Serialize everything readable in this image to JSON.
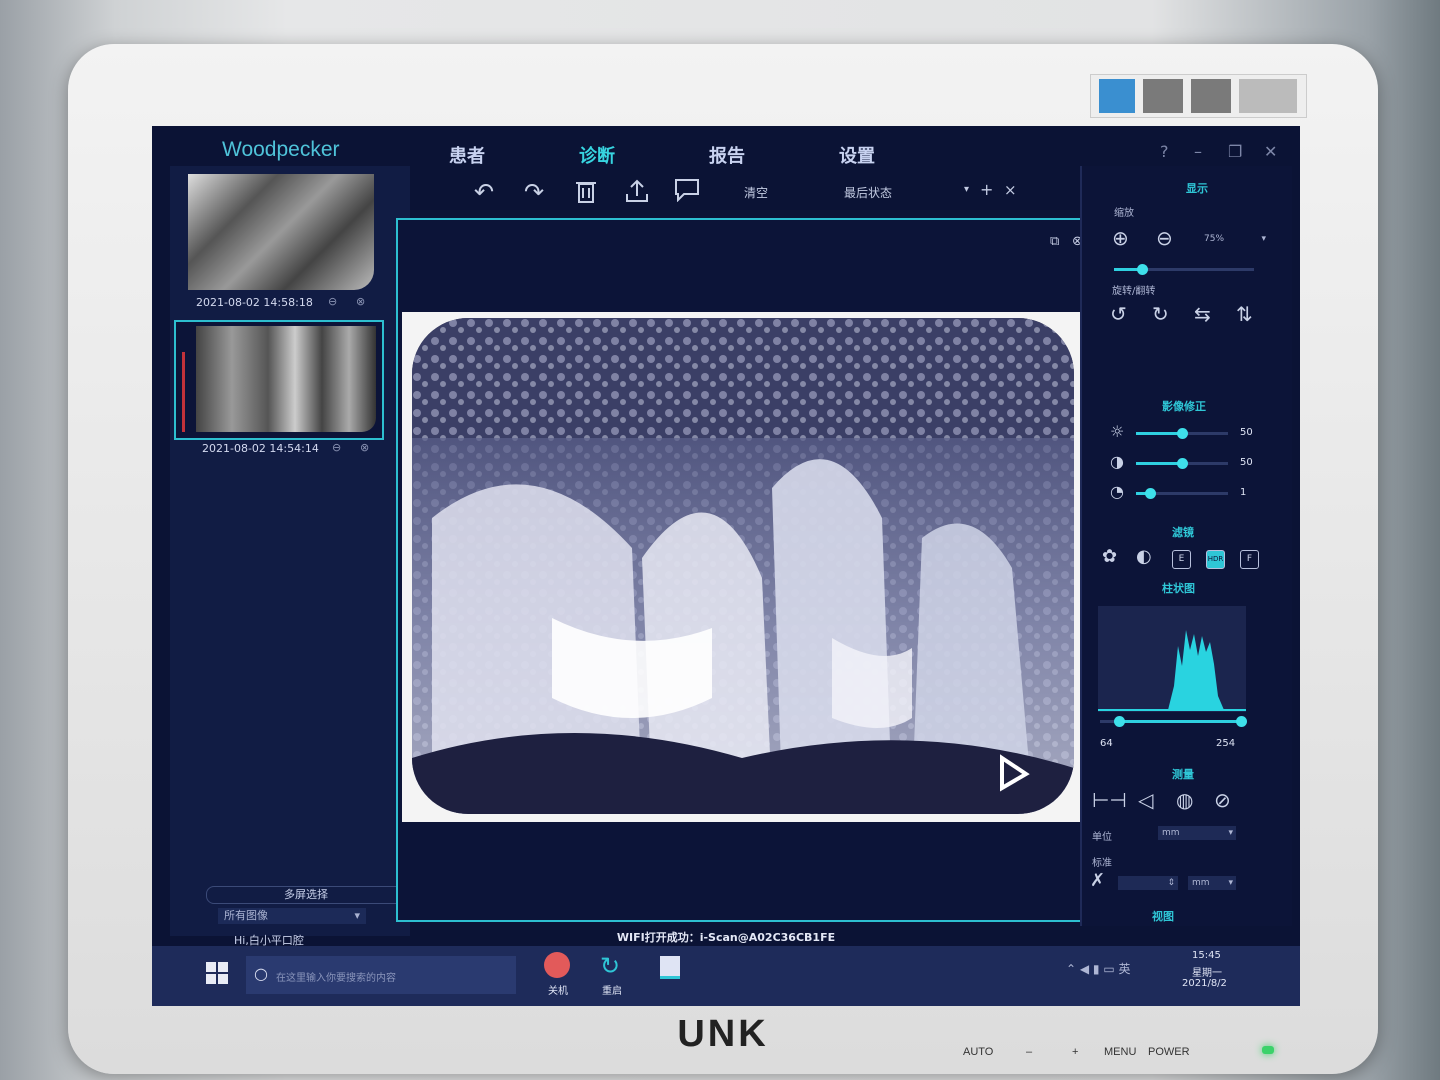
{
  "app": {
    "logo": "Woodpecker",
    "nav": [
      {
        "label": "患者",
        "active": false
      },
      {
        "label": "诊断",
        "active": true
      },
      {
        "label": "报告",
        "active": false
      },
      {
        "label": "设置",
        "active": false
      }
    ],
    "window_controls": {
      "help": "?",
      "minimize": "–",
      "restore": "❐",
      "close": "✕"
    }
  },
  "toolbar": {
    "clear_label": "清空",
    "last_state_label": "最后状态",
    "add": "+",
    "remove": "×"
  },
  "thumbnails": [
    {
      "date": "2021-08-02 14:58:18",
      "selected": false
    },
    {
      "date": "2021-08-02 14:54:14",
      "selected": true
    }
  ],
  "left_panel": {
    "multi_select_label": "多屏选择",
    "filter_value": "所有图像",
    "user_greeting": "Hi,白小平口腔"
  },
  "status_message": "WIFI打开成功：i-Scan@A02C36CB1FE",
  "right_panel": {
    "display_header": "显示",
    "zoom_label": "缩放",
    "zoom_value": "75%",
    "zoom_level": 0.2,
    "rotate_label": "旋转/翻转",
    "correction_header": "影像修正",
    "brightness": {
      "value": "50",
      "level": 0.5
    },
    "contrast": {
      "value": "50",
      "level": 0.5
    },
    "gamma": {
      "value": "1",
      "level": 0.15
    },
    "filter_header": "滤镜",
    "filter_buttons": [
      "E",
      "HDR",
      "F"
    ],
    "histogram_header": "柱状图",
    "histogram_min": "64",
    "histogram_max": "254",
    "measure_header": "测量",
    "unit_label": "单位",
    "unit_value": "mm",
    "calibrate_label": "标准",
    "calibrate_unit": "mm",
    "bottom_header": "视图"
  },
  "taskbar": {
    "search_placeholder": "在这里输入你要搜索的内容",
    "shutdown_label": "关机",
    "restart_label": "重启",
    "clock_time": "15:45",
    "clock_day": "星期一",
    "clock_date": "2021/8/2"
  },
  "monitor": {
    "brand": "UNK",
    "buttons": [
      "AUTO",
      "–",
      "+",
      "MENU",
      "POWER"
    ]
  }
}
